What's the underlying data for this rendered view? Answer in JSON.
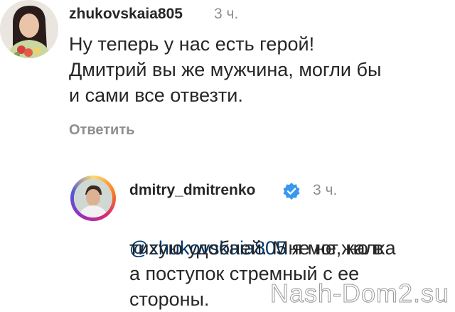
{
  "comment": {
    "username": "zhukovskaia805",
    "time": "3 ч.",
    "text": "Ну теперь у нас есть герой!\nДмитрий вы же мужчина, могли бы\nи сами все отвезти.",
    "reply_label": "Ответить"
  },
  "reply": {
    "username": "dmitry_dmitrenko",
    "time": "3 ч.",
    "mention": "@zhukovskaia805",
    "text_first": " я мог, но в",
    "text_rest": "тихую удобней. Мне не жалка\nа поступок стремный с ее\nстороны."
  },
  "watermark": "Nash-Dom2.su",
  "colors": {
    "username": "#262626",
    "muted": "#8e8e8e",
    "mention": "#00376b",
    "verified": "#3897f0"
  }
}
